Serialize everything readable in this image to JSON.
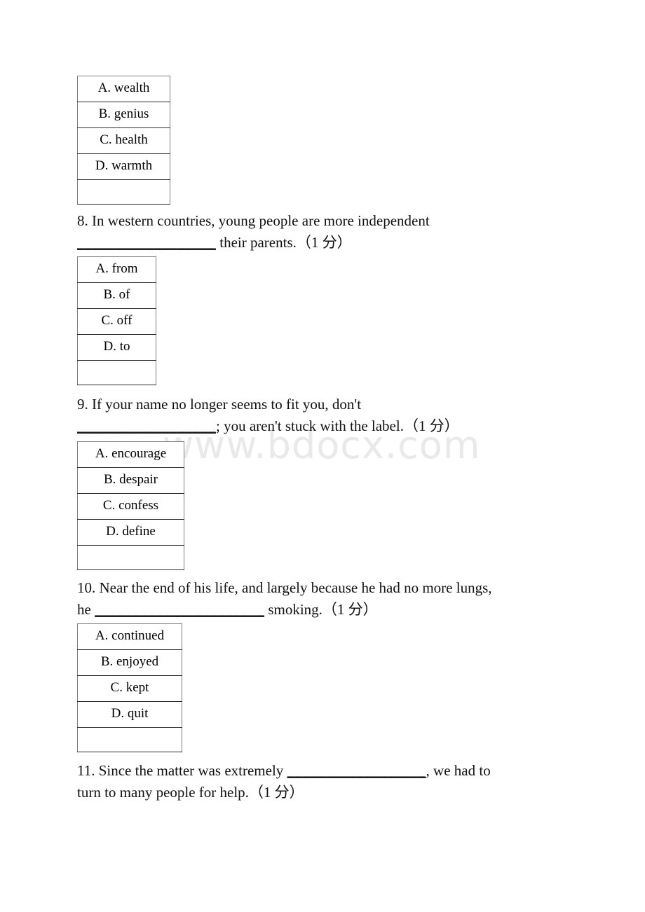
{
  "document": {
    "watermark": "www.bdocx.com",
    "language": "English exam worksheet (Chinese annotations)"
  },
  "questions": [
    {
      "id": "q7-options",
      "number": "",
      "options": [
        {
          "label": "A. wealth"
        },
        {
          "label": "B. genius"
        },
        {
          "label": "C. health"
        },
        {
          "label": "D. warmth"
        },
        {
          "label": ""
        }
      ]
    },
    {
      "id": "q8",
      "number": "8.",
      "text_line1": "8. In western countries, young people are more independent",
      "text_line2_blank": "__________________",
      "text_line2_rest": " their parents.",
      "score": "（1 分）",
      "options": [
        {
          "label": "A. from"
        },
        {
          "label": "B. of"
        },
        {
          "label": "C. off"
        },
        {
          "label": "D. to"
        },
        {
          "label": ""
        }
      ]
    },
    {
      "id": "q9",
      "number": "9.",
      "text_line1": "9. If your name no longer seems to fit you, don't",
      "text_line2_blank": "__________________",
      "text_line2_rest": "; you aren't stuck with the label.",
      "score": "（1 分）",
      "options": [
        {
          "label": "A. encourage"
        },
        {
          "label": "B. despair"
        },
        {
          "label": "C. confess"
        },
        {
          "label": "D. define"
        },
        {
          "label": ""
        }
      ]
    },
    {
      "id": "q10",
      "number": "10.",
      "text_line1": "10. Near the end of his life, and largely because he had no more lungs,",
      "text_line2_prefix": "he ",
      "text_line2_blank": "______________________",
      "text_line2_rest": " smoking.",
      "score": "（1 分）",
      "options": [
        {
          "label": "A. continued"
        },
        {
          "label": "B. enjoyed"
        },
        {
          "label": "C. kept"
        },
        {
          "label": "D. quit"
        },
        {
          "label": ""
        }
      ]
    },
    {
      "id": "q11",
      "number": "11.",
      "text_line1_prefix": "11. Since the matter was extremely ",
      "text_line1_blank": "__________________",
      "text_line1_rest": ", we had to",
      "text_line2": "turn to many people for help.",
      "score": "（1 分）"
    }
  ]
}
